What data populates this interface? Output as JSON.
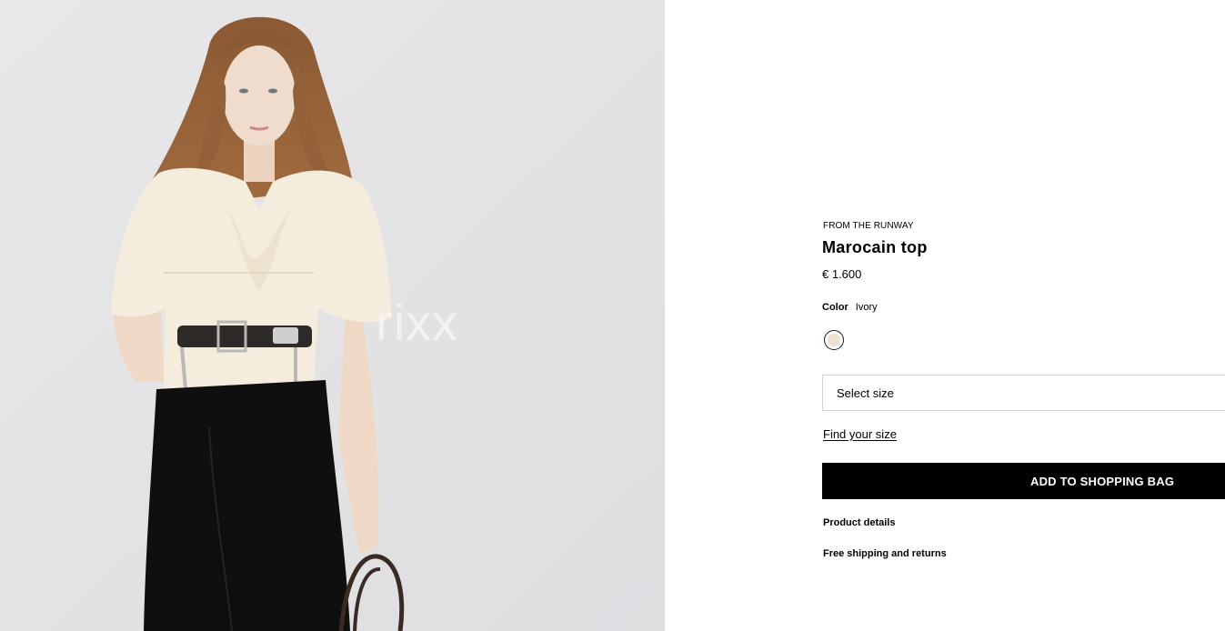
{
  "image": {
    "watermark": "rixx",
    "background_color": "#e6e6e8"
  },
  "product": {
    "eyebrow": "FROM THE RUNWAY",
    "title": "Marocain top",
    "price": "€ 1.600",
    "color_label": "Color",
    "color_value": "Ivory",
    "swatch_color": "#ede2cf",
    "size_select_placeholder": "Select size",
    "size_guide_link": "Find your size",
    "add_to_bag_label": "ADD TO SHOPPING BAG",
    "accordions": [
      {
        "label": "Product details"
      },
      {
        "label": "Free shipping and returns"
      }
    ]
  }
}
